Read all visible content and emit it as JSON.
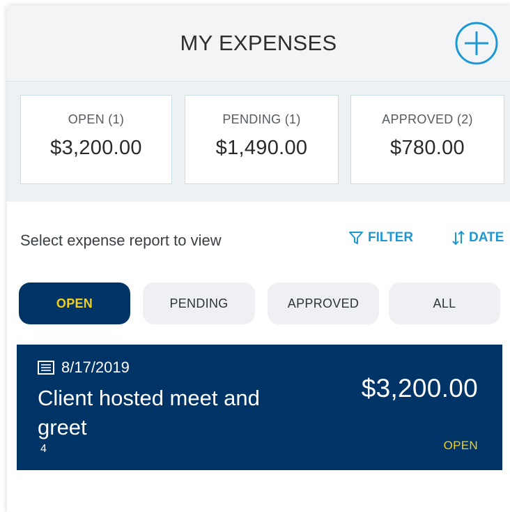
{
  "header": {
    "title": "MY EXPENSES",
    "add_icon": "plus-circle-icon",
    "accent_color": "#1e98d3"
  },
  "summary": {
    "cards": [
      {
        "label": "OPEN (1)",
        "value": "$3,200.00"
      },
      {
        "label": "PENDING (1)",
        "value": "$1,490.00"
      },
      {
        "label": "APPROVED (2)",
        "value": "$780.00"
      }
    ]
  },
  "list": {
    "prompt": "Select expense report to view",
    "filter_label": "FILTER",
    "filter_icon": "funnel-icon",
    "sort_label": "DATE",
    "sort_icon": "sort-arrows-icon",
    "tabs": [
      {
        "label": "OPEN",
        "active": true
      },
      {
        "label": "PENDING",
        "active": false
      },
      {
        "label": "APPROVED",
        "active": false
      },
      {
        "label": "ALL",
        "active": false
      }
    ],
    "active_tab_color": "#003466",
    "active_tab_text_color": "#f2cf1e"
  },
  "reports": [
    {
      "date": "8/17/2019",
      "date_icon": "receipt-icon",
      "title": "Client hosted meet and greet",
      "amount": "$3,200.00",
      "count": "4",
      "status": "OPEN"
    }
  ]
}
